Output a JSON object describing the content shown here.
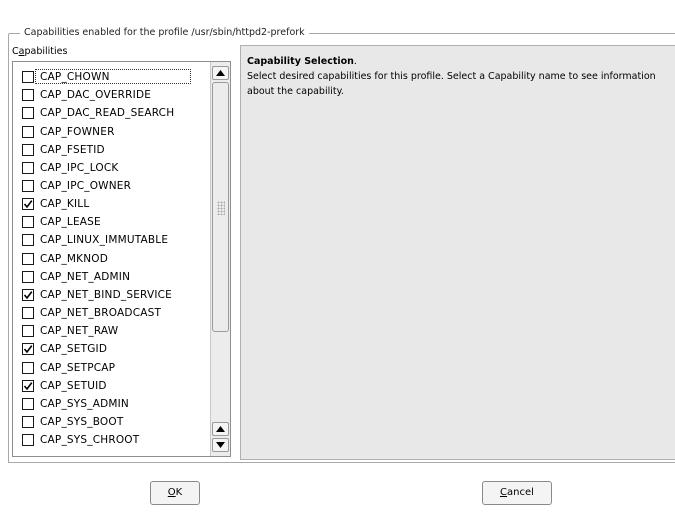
{
  "frame_title": "Capabilities enabled for the profile /usr/sbin/httpd2-prefork",
  "list_label": {
    "mnemonic": "a",
    "prefix": "C",
    "rest": "pabilities"
  },
  "capabilities": [
    {
      "name": "CAP_CHOWN",
      "checked": false,
      "focused": true
    },
    {
      "name": "CAP_DAC_OVERRIDE",
      "checked": false
    },
    {
      "name": "CAP_DAC_READ_SEARCH",
      "checked": false
    },
    {
      "name": "CAP_FOWNER",
      "checked": false
    },
    {
      "name": "CAP_FSETID",
      "checked": false
    },
    {
      "name": "CAP_IPC_LOCK",
      "checked": false
    },
    {
      "name": "CAP_IPC_OWNER",
      "checked": false
    },
    {
      "name": "CAP_KILL",
      "checked": true
    },
    {
      "name": "CAP_LEASE",
      "checked": false
    },
    {
      "name": "CAP_LINUX_IMMUTABLE",
      "checked": false
    },
    {
      "name": "CAP_MKNOD",
      "checked": false
    },
    {
      "name": "CAP_NET_ADMIN",
      "checked": false
    },
    {
      "name": "CAP_NET_BIND_SERVICE",
      "checked": true
    },
    {
      "name": "CAP_NET_BROADCAST",
      "checked": false
    },
    {
      "name": "CAP_NET_RAW",
      "checked": false
    },
    {
      "name": "CAP_SETGID",
      "checked": true
    },
    {
      "name": "CAP_SETPCAP",
      "checked": false
    },
    {
      "name": "CAP_SETUID",
      "checked": true
    },
    {
      "name": "CAP_SYS_ADMIN",
      "checked": false
    },
    {
      "name": "CAP_SYS_BOOT",
      "checked": false
    },
    {
      "name": "CAP_SYS_CHROOT",
      "checked": false
    }
  ],
  "help": {
    "title": "Capability Selection",
    "title_suffix": ".",
    "body": "Select desired capabilities for this profile. Select a Capability name to see information about the capability."
  },
  "buttons": {
    "ok": {
      "mnemonic": "O",
      "rest": "K"
    },
    "cancel": {
      "mnemonic": "C",
      "rest": "ancel"
    }
  }
}
